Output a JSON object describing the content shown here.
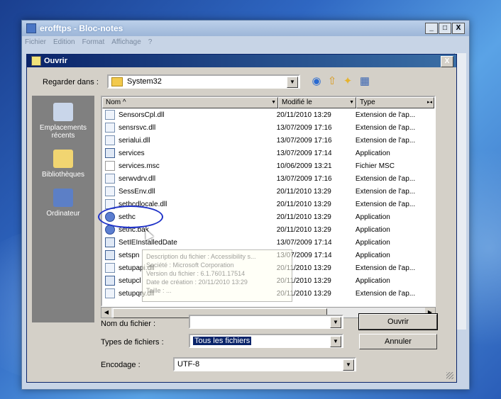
{
  "notepad": {
    "title": "erofftps - Bloc-notes",
    "menu": [
      "Fichier",
      "Edition",
      "Format",
      "Affichage",
      "?"
    ],
    "controls": [
      "_",
      "□",
      "X"
    ]
  },
  "dialog": {
    "title": "Ouvrir",
    "close": "X",
    "lookin_label": "Regarder dans :",
    "lookin_value": "System32",
    "places": [
      {
        "label": "Emplacements récents",
        "icon": "recent-places-icon"
      },
      {
        "label": "Bibliothèques",
        "icon": "libraries-icon"
      },
      {
        "label": "Ordinateur",
        "icon": "computer-icon"
      }
    ],
    "columns": {
      "name": "Nom",
      "modified": "Modifié le",
      "type": "Type"
    },
    "files": [
      {
        "name": "SensorsCpl.dll",
        "date": "20/11/2010 13:29",
        "type": "Extension de l'ap...",
        "icon": "dll"
      },
      {
        "name": "sensrsvc.dll",
        "date": "13/07/2009 17:16",
        "type": "Extension de l'ap...",
        "icon": "dll"
      },
      {
        "name": "serialui.dll",
        "date": "13/07/2009 17:16",
        "type": "Extension de l'ap...",
        "icon": "dll"
      },
      {
        "name": "services",
        "date": "13/07/2009 17:14",
        "type": "Application",
        "icon": "app"
      },
      {
        "name": "services.msc",
        "date": "10/06/2009 13:21",
        "type": "Fichier MSC",
        "icon": "msc"
      },
      {
        "name": "serwvdrv.dll",
        "date": "13/07/2009 17:16",
        "type": "Extension de l'ap...",
        "icon": "dll"
      },
      {
        "name": "SessEnv.dll",
        "date": "20/11/2010 13:29",
        "type": "Extension de l'ap...",
        "icon": "dll"
      },
      {
        "name": "setbcdlocale.dll",
        "date": "20/11/2010 13:29",
        "type": "Extension de l'ap...",
        "icon": "dll"
      },
      {
        "name": "sethc",
        "date": "20/11/2010 13:29",
        "type": "Application",
        "icon": "gear"
      },
      {
        "name": "sethc.bak",
        "date": "20/11/2010 13:29",
        "type": "Application",
        "icon": "gear"
      },
      {
        "name": "SetIEInstalledDate",
        "date": "13/07/2009 17:14",
        "type": "Application",
        "icon": "app"
      },
      {
        "name": "setspn",
        "date": "13/07/2009 17:14",
        "type": "Application",
        "icon": "app"
      },
      {
        "name": "setupapi.dll",
        "date": "20/11/2010 13:29",
        "type": "Extension de l'ap...",
        "icon": "dll"
      },
      {
        "name": "setupcl",
        "date": "20/11/2010 13:29",
        "type": "Application",
        "icon": "app"
      },
      {
        "name": "setupqry.dll",
        "date": "20/11/2010 13:29",
        "type": "Extension de l'ap...",
        "icon": "dll"
      }
    ],
    "tooltip": [
      "Description du fichier : Accessibility s...",
      "Société : Microsoft Corporation",
      "Version du fichier : 6.1.7601.17514",
      "Date de création : 20/11/2010 13:29",
      "Taille : ..."
    ],
    "filename_label": "Nom du fichier :",
    "filename_value": "",
    "filetype_label": "Types de fichiers :",
    "filetype_value": "Tous les fichiers",
    "encoding_label": "Encodage :",
    "encoding_value": "UTF-8",
    "open_button": "Ouvrir",
    "cancel_button": "Annuler"
  }
}
